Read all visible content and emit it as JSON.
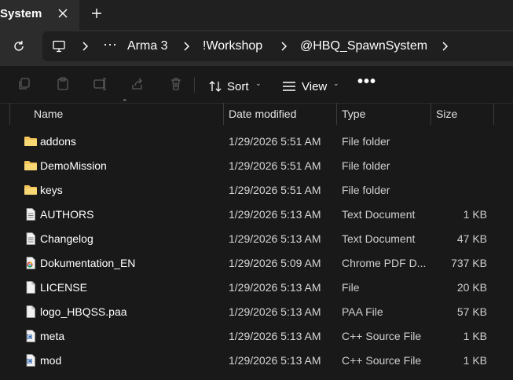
{
  "tab": {
    "title": "System"
  },
  "address": {
    "overflow": "···",
    "crumbs": [
      "Arma 3",
      "!Workshop",
      "@HBQ_SpawnSystem"
    ]
  },
  "toolbar": {
    "sort_label": "Sort",
    "view_label": "View",
    "more_label": "•••"
  },
  "columns": {
    "name": "Name",
    "date": "Date modified",
    "type": "Type",
    "size": "Size"
  },
  "files": [
    {
      "name": "addons",
      "date": "1/29/2026 5:51 AM",
      "type": "File folder",
      "size": "",
      "icon": "folder-icon"
    },
    {
      "name": "DemoMission",
      "date": "1/29/2026 5:51 AM",
      "type": "File folder",
      "size": "",
      "icon": "folder-icon"
    },
    {
      "name": "keys",
      "date": "1/29/2026 5:51 AM",
      "type": "File folder",
      "size": "",
      "icon": "folder-icon"
    },
    {
      "name": "AUTHORS",
      "date": "1/29/2026 5:13 AM",
      "type": "Text Document",
      "size": "1 KB",
      "icon": "text-file-icon"
    },
    {
      "name": "Changelog",
      "date": "1/29/2026 5:13 AM",
      "type": "Text Document",
      "size": "47 KB",
      "icon": "text-file-icon"
    },
    {
      "name": "Dokumentation_EN",
      "date": "1/29/2026 5:09 AM",
      "type": "Chrome PDF D...",
      "size": "737 KB",
      "icon": "chrome-pdf-icon"
    },
    {
      "name": "LICENSE",
      "date": "1/29/2026 5:13 AM",
      "type": "File",
      "size": "20 KB",
      "icon": "blank-file-icon"
    },
    {
      "name": "logo_HBQSS.paa",
      "date": "1/29/2026 5:13 AM",
      "type": "PAA File",
      "size": "57 KB",
      "icon": "blank-file-icon"
    },
    {
      "name": "meta",
      "date": "1/29/2026 5:13 AM",
      "type": "C++ Source File",
      "size": "1 KB",
      "icon": "cpp-file-icon"
    },
    {
      "name": "mod",
      "date": "1/29/2026 5:13 AM",
      "type": "C++ Source File",
      "size": "1 KB",
      "icon": "cpp-file-icon"
    }
  ],
  "colors": {
    "folder": "#f4c55a",
    "background": "#191919",
    "toolbar_bg": "#2c2c2c"
  }
}
